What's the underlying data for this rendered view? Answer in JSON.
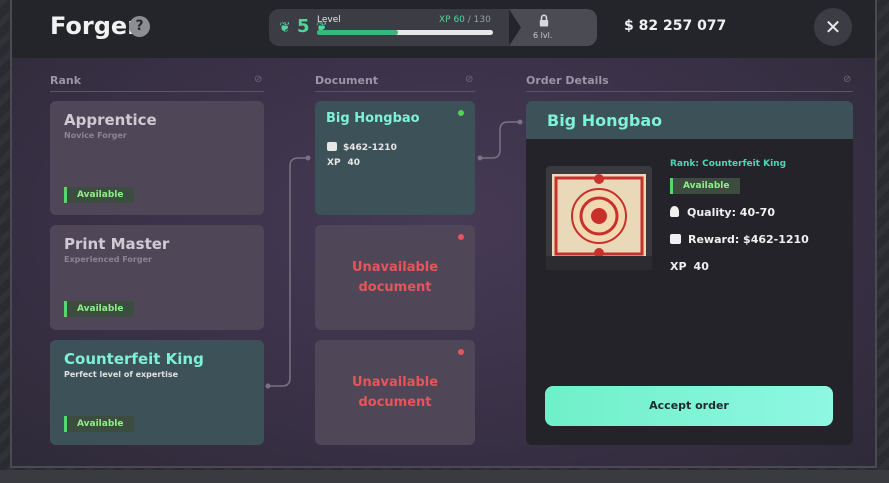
{
  "header": {
    "title": "Forger",
    "help_icon": "?",
    "level_number": "5",
    "level_label": "Level",
    "xp_current": "XP 60",
    "xp_max": " / 130",
    "xp_progress_fraction": 0.46,
    "locked_text": "6 lvl.",
    "money": "$ 82 257 077",
    "close_icon": "✕"
  },
  "columns": {
    "rank": "Rank",
    "document": "Document",
    "order_details": "Order Details"
  },
  "ranks": [
    {
      "title": "Apprentice",
      "subtitle": "Novice Forger",
      "status": "Available"
    },
    {
      "title": "Print Master",
      "subtitle": "Experienced Forger",
      "status": "Available"
    },
    {
      "title": "Counterfeit King",
      "subtitle": "Perfect level of expertise",
      "status": "Available"
    }
  ],
  "documents": {
    "active": {
      "title": "Big Hongbao",
      "reward": "$462-1210",
      "xp_label": "XP",
      "xp_value": "40",
      "dot_color": "#4fd64f"
    },
    "unavailable": [
      {
        "line1": "Unavailable",
        "line2": "document",
        "dot_color": "#e8545b"
      },
      {
        "line1": "Unavailable",
        "line2": "document",
        "dot_color": "#e8545b"
      }
    ]
  },
  "details": {
    "title": "Big Hongbao",
    "rank_text": "Rank: Counterfeit King",
    "status": "Available",
    "quality": "Quality: 40-70",
    "reward": "Reward: $462-1210",
    "xp_label": "XP",
    "xp_value": "40",
    "accept_label": "Accept order"
  }
}
